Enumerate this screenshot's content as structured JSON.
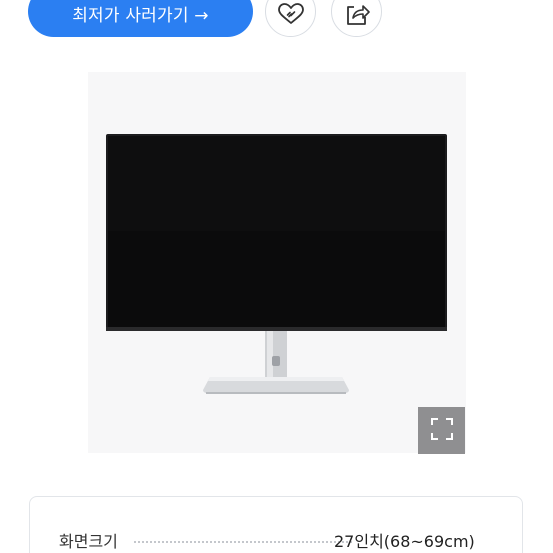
{
  "actions": {
    "buy_label": "최저가 사러가기 →",
    "wish_icon": "heart-link-icon",
    "share_icon": "share-icon"
  },
  "product_image": {
    "expand_icon": "expand-icon"
  },
  "specs": [
    {
      "label": "화면크기",
      "value": "27인치(68~69cm)"
    }
  ],
  "colors": {
    "accent": "#2b7ff2",
    "expand_button": "#8f8f91",
    "image_background": "#f7f7f8"
  }
}
